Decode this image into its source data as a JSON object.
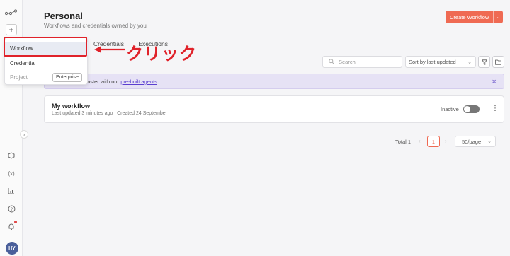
{
  "page": {
    "title": "Personal",
    "subtitle": "Workflows and credentials owned by you"
  },
  "header": {
    "create_label": "Create Workflow"
  },
  "tabs": {
    "credentials": "Credentials",
    "executions": "Executions"
  },
  "toolbar": {
    "search_placeholder": "Search",
    "sort_value": "Sort by last updated"
  },
  "banner": {
    "text": "faster with our",
    "link": "pre-built agents"
  },
  "workflow": {
    "name": "My workflow",
    "updated": "Last updated 3 minutes ago",
    "created": "Created 24 September",
    "status": "Inactive",
    "active": false
  },
  "pagination": {
    "total": "Total 1",
    "page": "1",
    "per_page": "50/page"
  },
  "dropdown": {
    "workflow": "Workflow",
    "credential": "Credential",
    "project": "Project",
    "enterprise": "Enterprise"
  },
  "annotation": {
    "text": "クリック",
    "color": "#e0222a"
  },
  "user": {
    "initials": "HY"
  },
  "colors": {
    "accent": "#ef6a53",
    "banner_bg": "#e6e2f5",
    "link": "#5b3fd0"
  }
}
